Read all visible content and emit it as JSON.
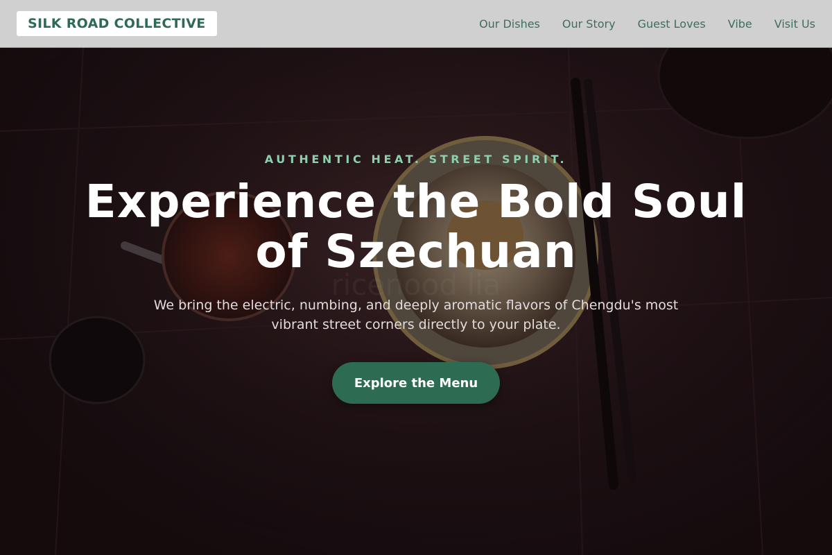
{
  "header": {
    "logo": "SILK ROAD COLLECTIVE",
    "nav": [
      {
        "label": "Our Dishes"
      },
      {
        "label": "Our Story"
      },
      {
        "label": "Guest Loves"
      },
      {
        "label": "Vibe"
      },
      {
        "label": "Visit Us"
      }
    ]
  },
  "hero": {
    "tagline": "AUTHENTIC HEAT. STREET SPIRIT.",
    "headline": "Experience the Bold Soul of Szechuan",
    "subtext": "We bring the electric, numbing, and deeply aromatic flavors of Chengdu's most vibrant street corners directly to your plate.",
    "cta_label": "Explore the Menu"
  },
  "colors": {
    "brand_green": "#2e6b53",
    "tagline_green": "#8fcfae",
    "header_bg": "#d1d0d0",
    "hero_bg": "#25161a"
  }
}
